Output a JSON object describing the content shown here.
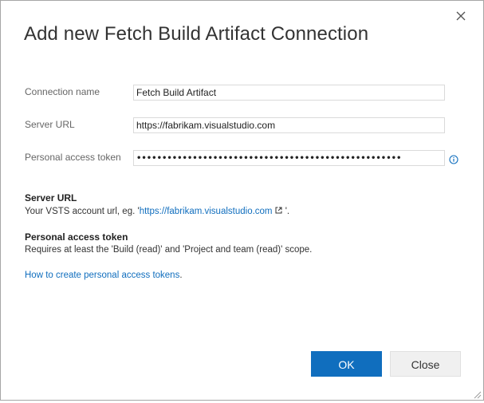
{
  "dialog": {
    "title": "Add new Fetch Build Artifact Connection"
  },
  "form": {
    "connection_name": {
      "label": "Connection name",
      "value": "Fetch Build Artifact"
    },
    "server_url": {
      "label": "Server URL",
      "value": "https://fabrikam.visualstudio.com"
    },
    "token": {
      "label": "Personal access token",
      "value": "••••••••••••••••••••••••••••••••••••••••••••••••••••"
    }
  },
  "help": {
    "server_url_heading": "Server URL",
    "server_url_prefix": "Your VSTS account url, eg. '",
    "server_url_link": "https://fabrikam.visualstudio.com",
    "server_url_suffix": " '.",
    "token_heading": "Personal access token",
    "token_text": "Requires at least the 'Build (read)' and 'Project and team (read)' scope.",
    "howto_link": "How to create personal access tokens",
    "howto_suffix": "."
  },
  "buttons": {
    "ok_label": "OK",
    "close_label": "Close"
  },
  "icons": {
    "close": "close-icon",
    "info": "info-icon",
    "external_link": "external-link-icon",
    "resize": "resize-grip-icon"
  },
  "colors": {
    "primary": "#106ebe",
    "link": "#106ebe",
    "title": "#333333",
    "label": "#666666"
  }
}
